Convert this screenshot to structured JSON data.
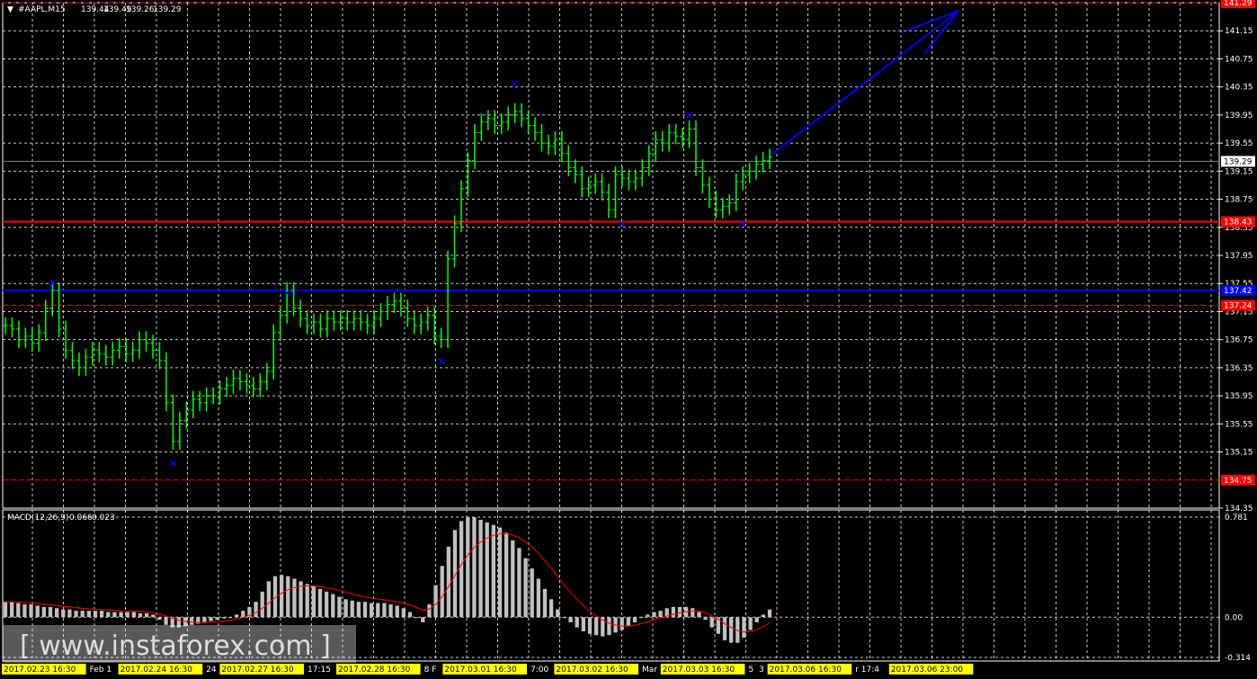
{
  "header": {
    "symbol": "#AAPL,M15",
    "open": "139.44",
    "high": "139.49",
    "low": "139.26",
    "close": "139.29"
  },
  "colors": {
    "background": "#000000",
    "grid": "#c8c8c8",
    "candles": "#00ff00",
    "blue_line": "#0000ff",
    "red_line": "#ff0000",
    "macd_hist": "#c0c0c0",
    "macd_signal": "#ff0000",
    "frame": "#ffffff",
    "date_label_bg": "#ffff00"
  },
  "chart_data": {
    "type": "candlestick",
    "y_ticks": [
      "141.15",
      "140.75",
      "140.35",
      "139.95",
      "139.55",
      "139.15",
      "138.75",
      "138.35",
      "137.95",
      "137.55",
      "137.15",
      "136.75",
      "136.35",
      "135.95",
      "135.55",
      "135.15",
      "134.35"
    ],
    "ylim": [
      134.35,
      141.55
    ],
    "price_series": [
      136.95,
      136.9,
      136.75,
      136.8,
      136.7,
      136.85,
      137.2,
      137.45,
      136.9,
      136.6,
      136.45,
      136.35,
      136.5,
      136.6,
      136.55,
      136.5,
      136.6,
      136.65,
      136.55,
      136.6,
      136.75,
      136.7,
      136.6,
      136.45,
      135.85,
      135.3,
      135.6,
      135.75,
      135.9,
      135.85,
      135.95,
      135.95,
      136.05,
      136.1,
      136.2,
      136.15,
      136.1,
      136.05,
      136.15,
      136.3,
      136.85,
      137.1,
      137.45,
      137.2,
      137.05,
      136.95,
      137.0,
      136.9,
      137.05,
      137.0,
      137.05,
      137.0,
      137.05,
      137.0,
      136.95,
      137.05,
      137.15,
      137.25,
      137.3,
      137.2,
      137.05,
      136.95,
      137.0,
      137.1,
      136.8,
      136.75,
      137.9,
      138.4,
      138.9,
      139.3,
      139.7,
      139.85,
      139.9,
      139.8,
      139.85,
      139.95,
      140.0,
      139.9,
      139.8,
      139.7,
      139.55,
      139.5,
      139.6,
      139.4,
      139.2,
      139.1,
      138.9,
      138.95,
      139.0,
      138.85,
      138.6,
      139.1,
      139.05,
      139.0,
      139.05,
      139.2,
      139.4,
      139.6,
      139.55,
      139.7,
      139.65,
      139.6,
      139.75,
      139.2,
      138.95,
      138.75,
      138.6,
      138.65,
      138.7,
      139.0,
      139.1,
      139.15,
      139.25,
      139.3,
      139.35
    ],
    "macd_hist": [
      0.12,
      0.12,
      0.11,
      0.1,
      0.1,
      0.09,
      0.08,
      0.08,
      0.07,
      0.06,
      0.06,
      0.05,
      0.05,
      0.05,
      0.05,
      0.05,
      0.04,
      0.04,
      0.04,
      0.04,
      0.04,
      0.03,
      0.03,
      0.02,
      -0.02,
      -0.06,
      -0.08,
      -0.08,
      -0.07,
      -0.06,
      -0.05,
      -0.04,
      -0.03,
      -0.02,
      -0.01,
      0.0,
      0.02,
      0.05,
      0.08,
      0.12,
      0.2,
      0.28,
      0.32,
      0.33,
      0.32,
      0.3,
      0.28,
      0.26,
      0.24,
      0.22,
      0.2,
      0.18,
      0.16,
      0.14,
      0.13,
      0.12,
      0.12,
      0.11,
      0.11,
      0.11,
      0.1,
      0.09,
      0.07,
      0.04,
      0.0,
      -0.04,
      0.1,
      0.25,
      0.4,
      0.55,
      0.68,
      0.75,
      0.78,
      0.78,
      0.76,
      0.74,
      0.72,
      0.7,
      0.66,
      0.6,
      0.54,
      0.46,
      0.38,
      0.3,
      0.22,
      0.14,
      0.06,
      0.0,
      -0.04,
      -0.08,
      -0.11,
      -0.13,
      -0.14,
      -0.15,
      -0.14,
      -0.12,
      -0.1,
      -0.07,
      -0.04,
      0.0,
      0.02,
      0.04,
      0.05,
      0.07,
      0.08,
      0.08,
      0.08,
      0.07,
      0.04,
      -0.02,
      -0.08,
      -0.13,
      -0.18,
      -0.2,
      -0.2,
      -0.16,
      -0.1,
      -0.04,
      0.02,
      0.06
    ],
    "macd_range": [
      -0.314,
      0.781
    ],
    "macd_ticks": [
      "0.781",
      "0.00",
      "-0.314"
    ],
    "h_lines": [
      {
        "price": 141.55,
        "label": "141.29",
        "color": "#ff0000",
        "style": "dash"
      },
      {
        "price": 138.43,
        "label": "138.43",
        "color": "#ff0000",
        "style": "solid"
      },
      {
        "price": 137.45,
        "label": "137.42",
        "color": "#0000ff",
        "style": "solid"
      },
      {
        "price": 137.24,
        "label": "137.24",
        "color": "#ff0000",
        "style": "dash"
      },
      {
        "price": 134.75,
        "label": "134.75",
        "color": "#ff0000",
        "style": "dash"
      }
    ],
    "current_price": {
      "price": 139.29,
      "label": "139.29"
    },
    "markers": [
      {
        "price": 137.55,
        "index": 7
      },
      {
        "price": 135.0,
        "index": 25
      },
      {
        "price": 137.42,
        "index": 42
      },
      {
        "price": 136.45,
        "index": 65
      },
      {
        "price": 140.4,
        "index": 76
      },
      {
        "price": 138.4,
        "index": 92
      },
      {
        "price": 139.95,
        "index": 102
      },
      {
        "price": 138.4,
        "index": 110
      }
    ],
    "x_labels": [
      {
        "text": "2017.02.23 16:30",
        "highlight": "#ffff00"
      },
      {
        "text": "Feb 1",
        "highlight": ""
      },
      {
        "text": "2017.02.24 16:30",
        "highlight": "#ffff00"
      },
      {
        "text": "24",
        "highlight": ""
      },
      {
        "text": "2017.02.27 16:30",
        "highlight": "#ffff00"
      },
      {
        "text": "17:15",
        "highlight": ""
      },
      {
        "text": "2017.02.28 16:30",
        "highlight": "#ffff00"
      },
      {
        "text": "8 F",
        "highlight": ""
      },
      {
        "text": "2017.03.01 16:30",
        "highlight": "#ffff00"
      },
      {
        "text": "7:00",
        "highlight": ""
      },
      {
        "text": "2017.03.02 16:30",
        "highlight": "#ffff00"
      },
      {
        "text": "Mar",
        "highlight": ""
      },
      {
        "text": "2017.03.03 16:30",
        "highlight": "#ffff00"
      },
      {
        "text": "5",
        "highlight": ""
      },
      {
        "text": "3",
        "highlight": ""
      },
      {
        "text": "2017.03.06 16:30",
        "highlight": "#ffff00"
      },
      {
        "text": "r 17:4",
        "highlight": ""
      },
      {
        "text": "2017.03.06 23:00",
        "highlight": "#ffff00"
      }
    ]
  },
  "indicator": {
    "name": "MACD(12,26,9)",
    "value1": "0.066",
    "value2": "0.023"
  },
  "watermark": {
    "text": "[ www.instaforex.com ]"
  }
}
